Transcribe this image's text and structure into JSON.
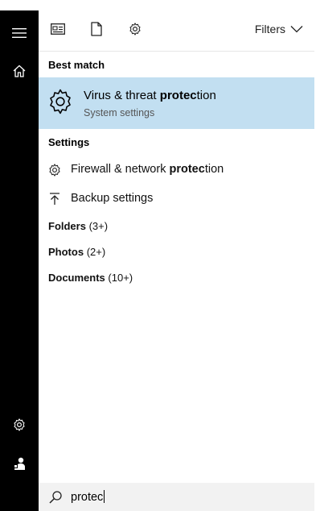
{
  "rail": {
    "items": [
      {
        "icon": "hamburger-menu-icon"
      },
      {
        "icon": "home-icon"
      },
      {
        "icon": "settings-gear-icon"
      },
      {
        "icon": "user-account-icon"
      }
    ]
  },
  "toolbar": {
    "icons": [
      "news-apps-icon",
      "documents-icon",
      "settings-filter-icon"
    ],
    "filters_label": "Filters"
  },
  "best_match": {
    "header": "Best match",
    "title_pre": "Virus & threat ",
    "title_match": "protec",
    "title_post": "tion",
    "subtitle": "System settings"
  },
  "settings": {
    "header": "Settings",
    "items": [
      {
        "icon": "gear-icon",
        "pre": "Firewall & network ",
        "match": "protec",
        "post": "tion"
      },
      {
        "icon": "backup-arrow-icon",
        "pre": "Backup settings",
        "match": "",
        "post": ""
      }
    ]
  },
  "groups": [
    {
      "label": "Folders",
      "count": "(3+)"
    },
    {
      "label": "Photos",
      "count": "(2+)"
    },
    {
      "label": "Documents",
      "count": "(10+)"
    }
  ],
  "search": {
    "query": "protec"
  },
  "colors": {
    "rail_bg": "#000000",
    "highlight": "#c2dff1",
    "search_bg": "#f2f2f2"
  }
}
